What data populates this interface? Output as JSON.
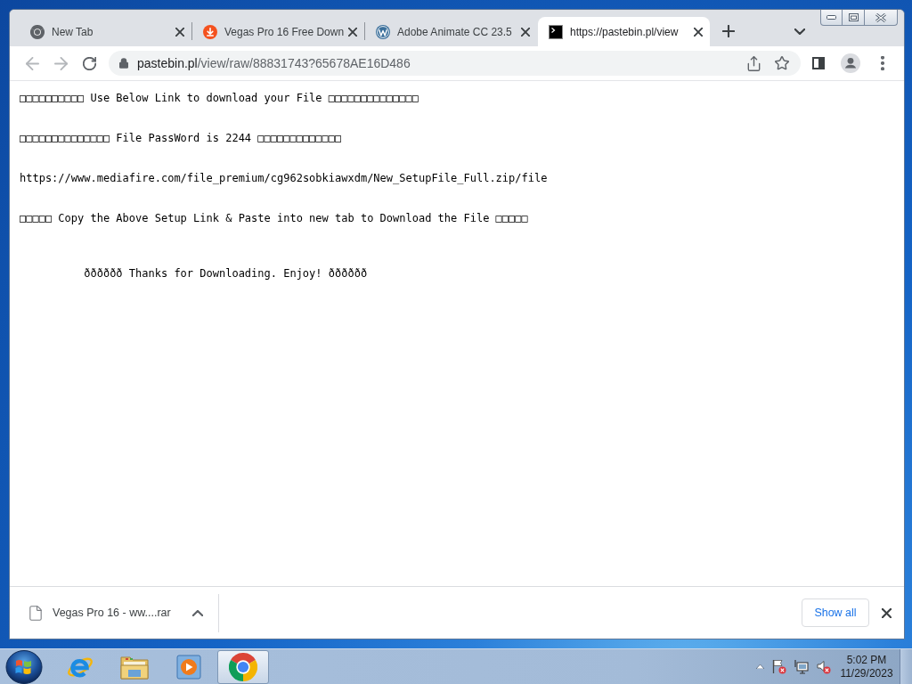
{
  "tabs": [
    {
      "kind": "browser",
      "title": "New Tab",
      "selected": false
    },
    {
      "kind": "download",
      "title": "Vegas Pro 16 Free Down",
      "selected": false
    },
    {
      "kind": "blog",
      "title": "Adobe Animate CC 23.5",
      "selected": false
    },
    {
      "kind": "terminal",
      "title": "https://pastebin.pl/view",
      "selected": true
    }
  ],
  "toolbar": {
    "back": {
      "disabled": true
    },
    "forward": {
      "disabled": true
    },
    "address": {
      "host": "pastebin.pl",
      "path": "/view/raw/88831743?65678AE16D486"
    }
  },
  "page": {
    "lines": [
      {
        "kind": "plain",
        "text": "□□□□□□□□□□ Use Below Link to download your File □□□□□□□□□□□□□□"
      },
      {
        "kind": "plain",
        "text": "□□□□□□□□□□□□□□ File PassWord is 2244 □□□□□□□□□□□□□"
      },
      {
        "kind": "plain",
        "text": "https://www.mediafire.com/file_premium/cg962sobkiawxdm/New_SetupFile_Full.zip/file"
      },
      {
        "kind": "plain",
        "text": "□□□□□ Copy the Above Setup Link & Paste into new tab to Download the File □□□□□"
      },
      {
        "kind": "indented",
        "text": "ðððððð Thanks for Downloading. Enjoy! ðððððð"
      }
    ]
  },
  "downloads": {
    "items": [
      {
        "name": "Vegas Pro 16 - ww....rar"
      }
    ],
    "show_all": "Show all"
  },
  "taskbar": {
    "apps": [
      {
        "kind": "globe",
        "selected": false
      },
      {
        "kind": "folder",
        "selected": false
      },
      {
        "kind": "player",
        "selected": false
      },
      {
        "kind": "browser",
        "selected": true
      }
    ],
    "clock": {
      "time": "5:02 PM",
      "date": "11/29/2023"
    }
  }
}
